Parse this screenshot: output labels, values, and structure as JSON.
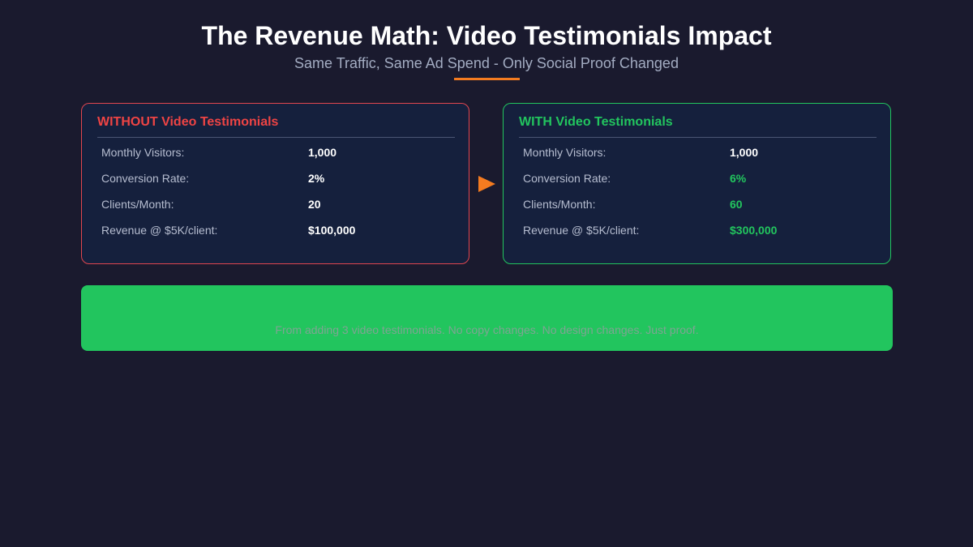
{
  "header": {
    "title": "The Revenue Math: Video Testimonials Impact",
    "subtitle": "Same Traffic, Same Ad Spend - Only Social Proof Changed"
  },
  "without": {
    "title": "WITHOUT Video Testimonials",
    "rows": [
      {
        "label": "Monthly Visitors:",
        "value": "1,000"
      },
      {
        "label": "Conversion Rate:",
        "value": "2%"
      },
      {
        "label": "Clients/Month:",
        "value": "20"
      },
      {
        "label": "Revenue @ $5K/client:",
        "value": "$100,000"
      }
    ]
  },
  "with": {
    "title": "WITH Video Testimonials",
    "rows": [
      {
        "label": "Monthly Visitors:",
        "value": "1,000"
      },
      {
        "label": "Conversion Rate:",
        "value": "6%"
      },
      {
        "label": "Clients/Month:",
        "value": "60"
      },
      {
        "label": "Revenue @ $5K/client:",
        "value": "$300,000"
      }
    ]
  },
  "banner": {
    "text": "From adding 3 video testimonials. No copy changes. No design changes. Just proof."
  },
  "colors": {
    "background": "#1a1a2e",
    "card": "#15203d",
    "accent_orange": "#f47b20",
    "red": "#ef4444",
    "green": "#22c55e"
  },
  "icons": {
    "arrow": "play-arrow-icon"
  }
}
